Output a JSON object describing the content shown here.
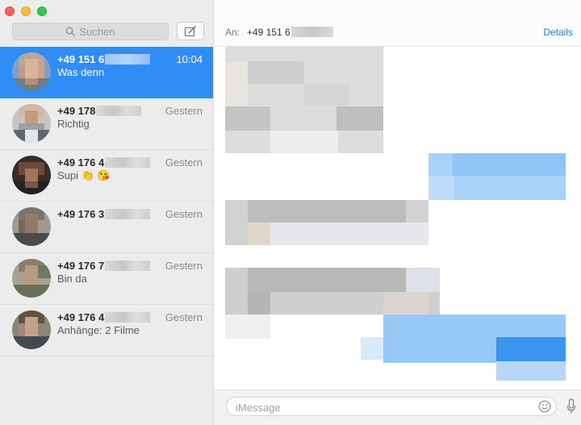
{
  "sidebar": {
    "search_placeholder": "Suchen",
    "conversations": [
      {
        "name": "+49 151 6",
        "time": "10:04",
        "preview": "Was denn",
        "selected": true
      },
      {
        "name": "+49 178",
        "time": "Gestern",
        "preview": "Richtig"
      },
      {
        "name": "+49 176 4",
        "time": "Gestern",
        "preview": "Supi 👏 😘"
      },
      {
        "name": "+49 176 3",
        "time": "Gestern",
        "preview": ""
      },
      {
        "name": "+49 176 7",
        "time": "Gestern",
        "preview": "Bin da"
      },
      {
        "name": "+49 176 4",
        "time": "Gestern",
        "preview": "Anhänge: 2 Filme"
      }
    ]
  },
  "header": {
    "to_label": "An:",
    "to_value": "+49 151 6",
    "details_label": "Details"
  },
  "input": {
    "placeholder": "iMessage"
  },
  "colors": {
    "selection": "#2f8df8",
    "link": "#2a7ad5"
  },
  "icons": [
    "search-icon",
    "compose-icon",
    "emoji-icon",
    "microphone-icon"
  ]
}
